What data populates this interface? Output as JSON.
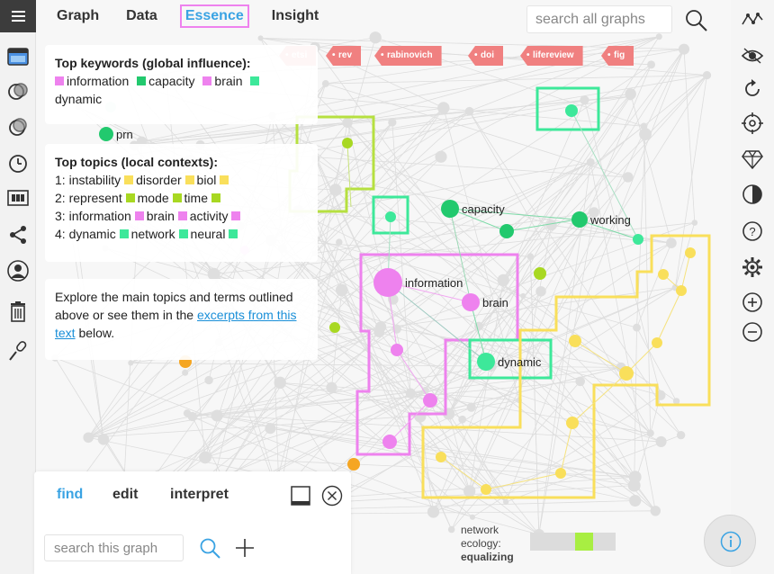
{
  "nav": {
    "tabs": [
      {
        "label": "Graph"
      },
      {
        "label": "Data"
      },
      {
        "label": "Essence"
      },
      {
        "label": "Insight"
      }
    ],
    "search_placeholder": "search all graphs"
  },
  "tags": [
    "etsi",
    "rev",
    "rabinovich",
    "doi",
    "lifereview",
    "fig"
  ],
  "keywords": {
    "heading": "Top keywords (global influence):",
    "items": [
      {
        "label": "information",
        "color": "#ee82ee"
      },
      {
        "label": "capacity",
        "color": "#22c96e"
      },
      {
        "label": "brain",
        "color": "#ee82ee"
      },
      {
        "label": "dynamic",
        "color": "#3de89a"
      }
    ]
  },
  "topics": {
    "heading": "Top topics (local contexts):",
    "items": [
      {
        "prefix": "1:",
        "words": [
          "instability",
          "disorder",
          "biol"
        ],
        "color": "#f9df5b"
      },
      {
        "prefix": "2:",
        "words": [
          "represent",
          "mode",
          "time"
        ],
        "color": "#a8d822"
      },
      {
        "prefix": "3:",
        "words": [
          "information",
          "brain",
          "activity"
        ],
        "color": "#ee82ee"
      },
      {
        "prefix": "4:",
        "words": [
          "dynamic",
          "network",
          "neural"
        ],
        "color": "#3de89a"
      }
    ]
  },
  "explore": {
    "text_before": "Explore the main topics and terms outlined above or see them in the ",
    "link": "excerpts from this text",
    "text_after": " below."
  },
  "graph": {
    "labels": {
      "prn": "prn",
      "capacity": "capacity",
      "working": "working",
      "information": "information",
      "brain": "brain",
      "dynamic": "dynamic"
    }
  },
  "find_panel": {
    "tabs": [
      {
        "label": "find"
      },
      {
        "label": "edit"
      },
      {
        "label": "interpret"
      }
    ],
    "search_placeholder": "search this graph"
  },
  "ecology": {
    "line1": "network",
    "line2": "ecology:",
    "state": "equalizing"
  },
  "colors": {
    "accent_blue": "#3aa3e3",
    "highlight_pink": "#ee82ee",
    "tag_red": "#f08080",
    "topic_yellow": "#f9df5b",
    "topic_lime": "#a8d822",
    "topic_green": "#3de89a",
    "node_green": "#22c96e",
    "eco_active": "#a8ee42"
  }
}
